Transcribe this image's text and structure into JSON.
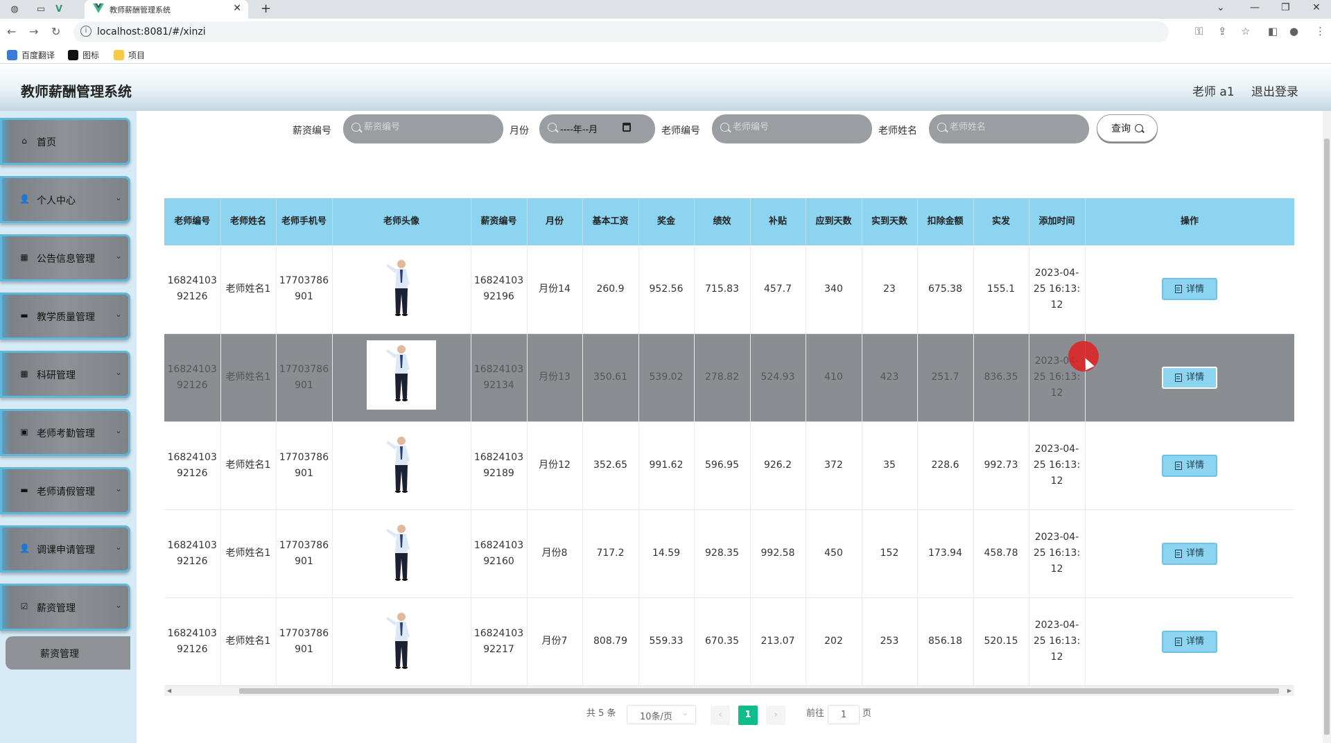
{
  "browser": {
    "tab_title": "教师薪酬管理系统",
    "url": "localhost:8081/#/xinzi",
    "bookmarks": [
      "百度翻译",
      "图标",
      "项目"
    ]
  },
  "app": {
    "title": "教师薪酬管理系统",
    "user": "老师 a1",
    "logout": "退出登录"
  },
  "sidebar": {
    "items": [
      {
        "label": "首页",
        "icon": "home-icon"
      },
      {
        "label": "个人中心",
        "icon": "user-icon"
      },
      {
        "label": "公告信息管理",
        "icon": "grid-icon"
      },
      {
        "label": "教学质量管理",
        "icon": "monitor-icon"
      },
      {
        "label": "科研管理",
        "icon": "grid-icon"
      },
      {
        "label": "老师考勤管理",
        "icon": "clipboard-icon"
      },
      {
        "label": "老师请假管理",
        "icon": "monitor-icon"
      },
      {
        "label": "调课申请管理",
        "icon": "user-icon"
      },
      {
        "label": "薪资管理",
        "icon": "checkbox-icon"
      }
    ],
    "sub_item": "薪资管理"
  },
  "search": {
    "salary_no_label": "薪资编号",
    "salary_no_placeholder": "薪资编号",
    "month_label": "月份",
    "month_value": "----年--月",
    "teacher_no_label": "老师编号",
    "teacher_no_placeholder": "老师编号",
    "teacher_name_label": "老师姓名",
    "teacher_name_placeholder": "老师姓名",
    "query_button": "查询"
  },
  "table": {
    "columns": [
      "老师编号",
      "老师姓名",
      "老师手机号",
      "老师头像",
      "薪资编号",
      "月份",
      "基本工资",
      "奖金",
      "绩效",
      "补贴",
      "应到天数",
      "实到天数",
      "扣除金额",
      "实发",
      "添加时间",
      "操作"
    ],
    "detail_label": "详情",
    "rows": [
      {
        "teacher_no": "1682410392126",
        "teacher_name": "老师姓名1",
        "phone": "17703786901",
        "salary_no": "1682410392196",
        "month": "月份14",
        "base": "260.9",
        "bonus": "952.56",
        "perf": "715.83",
        "subsidy": "457.7",
        "due_days": "340",
        "actual_days": "23",
        "deduct": "675.38",
        "net": "155.1",
        "added": "2023-04-25 16:13:12"
      },
      {
        "teacher_no": "1682410392126",
        "teacher_name": "老师姓名1",
        "phone": "17703786901",
        "salary_no": "1682410392134",
        "month": "月份13",
        "base": "350.61",
        "bonus": "539.02",
        "perf": "278.82",
        "subsidy": "524.93",
        "due_days": "410",
        "actual_days": "423",
        "deduct": "251.7",
        "net": "836.35",
        "added": "2023-04-25 16:13:12"
      },
      {
        "teacher_no": "1682410392126",
        "teacher_name": "老师姓名1",
        "phone": "17703786901",
        "salary_no": "1682410392189",
        "month": "月份12",
        "base": "352.65",
        "bonus": "991.62",
        "perf": "596.95",
        "subsidy": "926.2",
        "due_days": "372",
        "actual_days": "35",
        "deduct": "228.6",
        "net": "992.73",
        "added": "2023-04-25 16:13:12"
      },
      {
        "teacher_no": "1682410392126",
        "teacher_name": "老师姓名1",
        "phone": "17703786901",
        "salary_no": "1682410392160",
        "month": "月份8",
        "base": "717.2",
        "bonus": "14.59",
        "perf": "928.35",
        "subsidy": "992.58",
        "due_days": "450",
        "actual_days": "152",
        "deduct": "173.94",
        "net": "458.78",
        "added": "2023-04-25 16:13:12"
      },
      {
        "teacher_no": "1682410392126",
        "teacher_name": "老师姓名1",
        "phone": "17703786901",
        "salary_no": "1682410392217",
        "month": "月份7",
        "base": "808.79",
        "bonus": "559.33",
        "perf": "670.35",
        "subsidy": "213.07",
        "due_days": "202",
        "actual_days": "253",
        "deduct": "856.18",
        "net": "520.15",
        "added": "2023-04-25 16:13:12"
      }
    ]
  },
  "pagination": {
    "total": "共 5 条",
    "page_size": "10条/页",
    "current": "1",
    "goto_label": "前往",
    "goto_value": "1",
    "page_suffix": "页"
  },
  "colors": {
    "header_bg": "#8dd4f0",
    "active_page": "#0fbc8c",
    "sidebar_bg": "#d6ebf6"
  }
}
